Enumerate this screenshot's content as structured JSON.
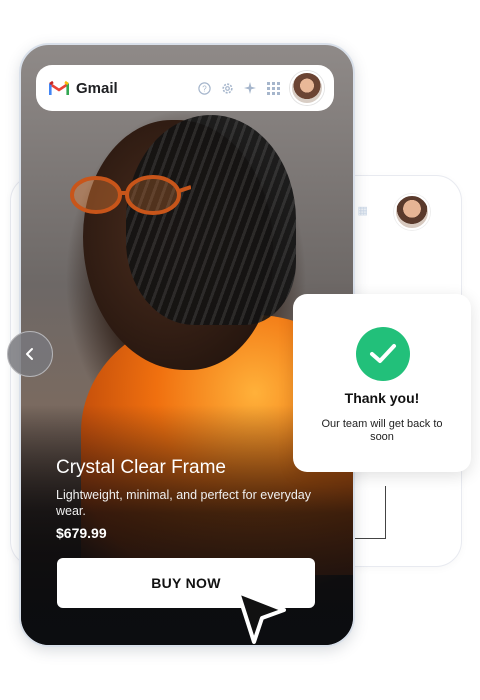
{
  "header": {
    "app_name": "Gmail",
    "icons": [
      "help-icon",
      "settings-icon",
      "sparkle-icon",
      "apps-grid-icon"
    ]
  },
  "product": {
    "title": "Crystal Clear Frame",
    "description": "Lightweight, minimal, and perfect for everyday wear.",
    "price": "$679.99",
    "cta_label": "BUY NOW"
  },
  "confirmation": {
    "title": "Thank you!",
    "message": "Our team will get back to soon"
  },
  "colors": {
    "success": "#22c07a",
    "accent_orange": "#f0700f",
    "gmail_red": "#ea4335",
    "gmail_blue": "#4285f4",
    "gmail_green": "#34a853",
    "gmail_yellow": "#fbbc04"
  }
}
